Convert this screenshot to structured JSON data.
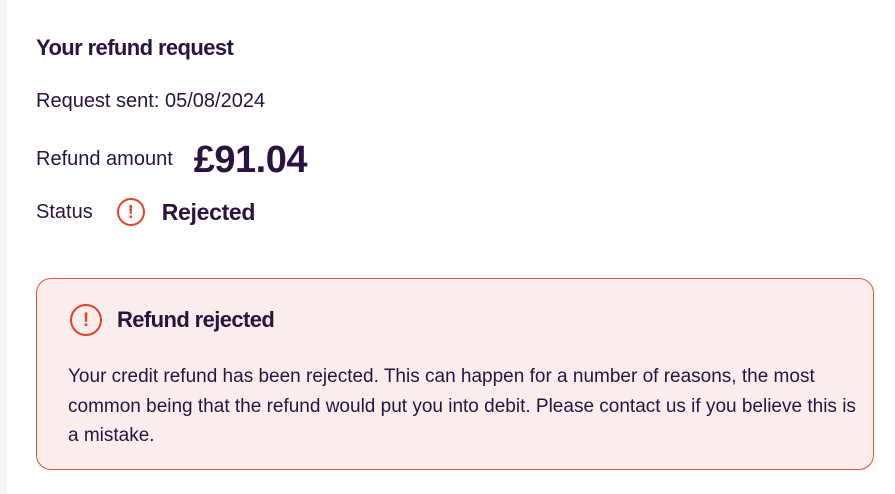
{
  "refund": {
    "title": "Your refund request",
    "request_sent": "Request sent: 05/08/2024",
    "amount_label": "Refund amount",
    "amount_value": "£91.04",
    "status_label": "Status",
    "status_value": "Rejected"
  },
  "alert": {
    "icon": "exclamation-circle-icon",
    "title": "Refund rejected",
    "message": "Your credit refund has been rejected. This can happen for a number of reasons, the most common being that the refund would put you into debit. Please contact us if you believe this is a mistake."
  },
  "colors": {
    "text": "#2b1240",
    "error": "#e0442a",
    "alert_background": "#fbedeb",
    "alert_border": "#d9553f"
  }
}
